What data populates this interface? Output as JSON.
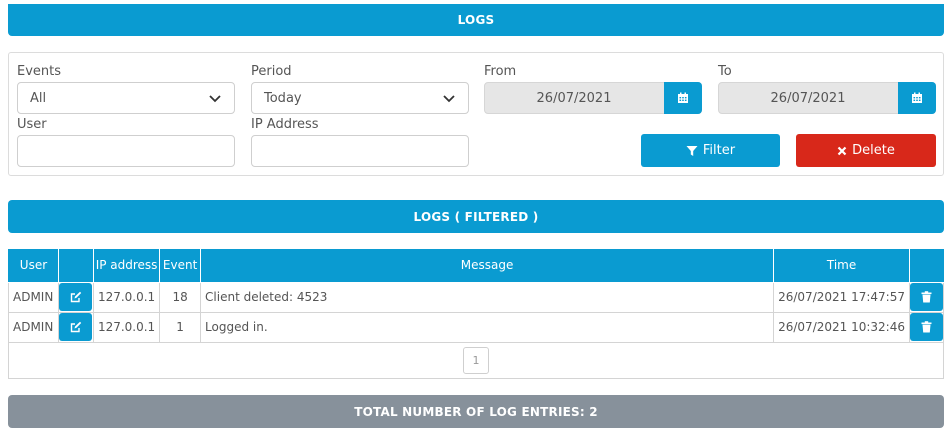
{
  "header": {
    "title": "LOGS"
  },
  "filters": {
    "events": {
      "label": "Events",
      "value": "All"
    },
    "period": {
      "label": "Period",
      "value": "Today"
    },
    "from": {
      "label": "From",
      "value": "26/07/2021"
    },
    "to": {
      "label": "To",
      "value": "26/07/2021"
    },
    "user": {
      "label": "User",
      "value": ""
    },
    "ip": {
      "label": "IP Address",
      "value": ""
    },
    "filter_label": "Filter",
    "delete_label": "Delete"
  },
  "filtered_header": {
    "title": "LOGS ( FILTERED )"
  },
  "table": {
    "columns": [
      "User",
      "",
      "IP address",
      "Event",
      "Message",
      "Time",
      ""
    ],
    "rows": [
      {
        "user": "ADMIN",
        "ip": "127.0.0.1",
        "event": "18",
        "message": "Client deleted: 4523",
        "time": "26/07/2021 17:47:57"
      },
      {
        "user": "ADMIN",
        "ip": "127.0.0.1",
        "event": "1",
        "message": "Logged in.",
        "time": "26/07/2021 10:32:46"
      }
    ]
  },
  "pagination": {
    "current": "1"
  },
  "footer": {
    "total_label": "TOTAL NUMBER OF LOG ENTRIES: 2"
  },
  "colors": {
    "primary": "#0a9bd1",
    "danger": "#d8281a",
    "footer": "#87919b"
  },
  "icons": {
    "select": "chevron-down-icon",
    "date": "calendar-icon",
    "filter": "funnel-icon",
    "delete": "x-icon",
    "edit": "edit-icon",
    "trash": "trash-icon"
  }
}
